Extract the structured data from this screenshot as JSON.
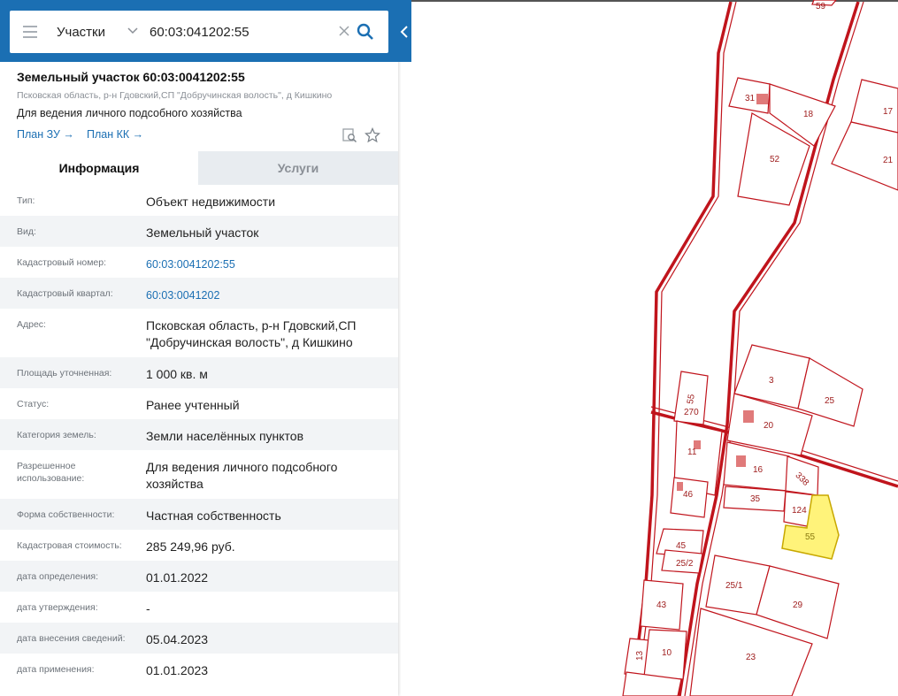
{
  "search": {
    "type_label": "Участки",
    "query": "60:03:041202:55"
  },
  "header": {
    "title": "Земельный участок 60:03:0041202:55",
    "address": "Псковская область, р-н Гдовский,СП \"Добручинская волость\", д Кишкино",
    "purpose": "Для ведения личного подсобного хозяйства",
    "plan_zu": "План ЗУ →",
    "plan_kk": "План КК →"
  },
  "tabs": {
    "info": "Информация",
    "services": "Услуги"
  },
  "details": [
    {
      "label": "Тип:",
      "value": "Объект недвижимости"
    },
    {
      "label": "Вид:",
      "value": "Земельный участок"
    },
    {
      "label": "Кадастровый номер:",
      "value": "60:03:0041202:55"
    },
    {
      "label": "Кадастровый квартал:",
      "value": "60:03:0041202"
    },
    {
      "label": "Адрес:",
      "value": "Псковская область, р-н Гдовский,СП \"Добручинская волость\", д Кишкино"
    },
    {
      "label": "Площадь уточненная:",
      "value": "1 000 кв. м"
    },
    {
      "label": "Статус:",
      "value": "Ранее учтенный"
    },
    {
      "label": "Категория земель:",
      "value": "Земли населённых пунктов"
    },
    {
      "label": "Разрешенное использование:",
      "value": "Для ведения личного подсобного хозяйства"
    },
    {
      "label": "Форма собственности:",
      "value": "Частная собственность"
    },
    {
      "label": "Кадастровая стоимость:",
      "value": "285 249,96 руб."
    },
    {
      "label": "дата определения:",
      "value": "01.01.2022"
    },
    {
      "label": "дата утверждения:",
      "value": "-"
    },
    {
      "label": "дата внесения сведений:",
      "value": "05.04.2023"
    },
    {
      "label": "дата применения:",
      "value": "01.01.2023"
    }
  ],
  "map": {
    "parcel_labels": [
      "59",
      "31",
      "18",
      "17",
      "21",
      "52",
      "3",
      "25",
      "55",
      "270",
      "20",
      "11",
      "16",
      "338",
      "46",
      "35",
      "124",
      "55",
      "45",
      "25/2",
      "25/1",
      "29",
      "43",
      "23",
      "13",
      "10"
    ]
  },
  "colors": {
    "brand": "#1b6fb3",
    "parcel_border": "#c0141c",
    "selected_parcel": "#fff37a"
  }
}
